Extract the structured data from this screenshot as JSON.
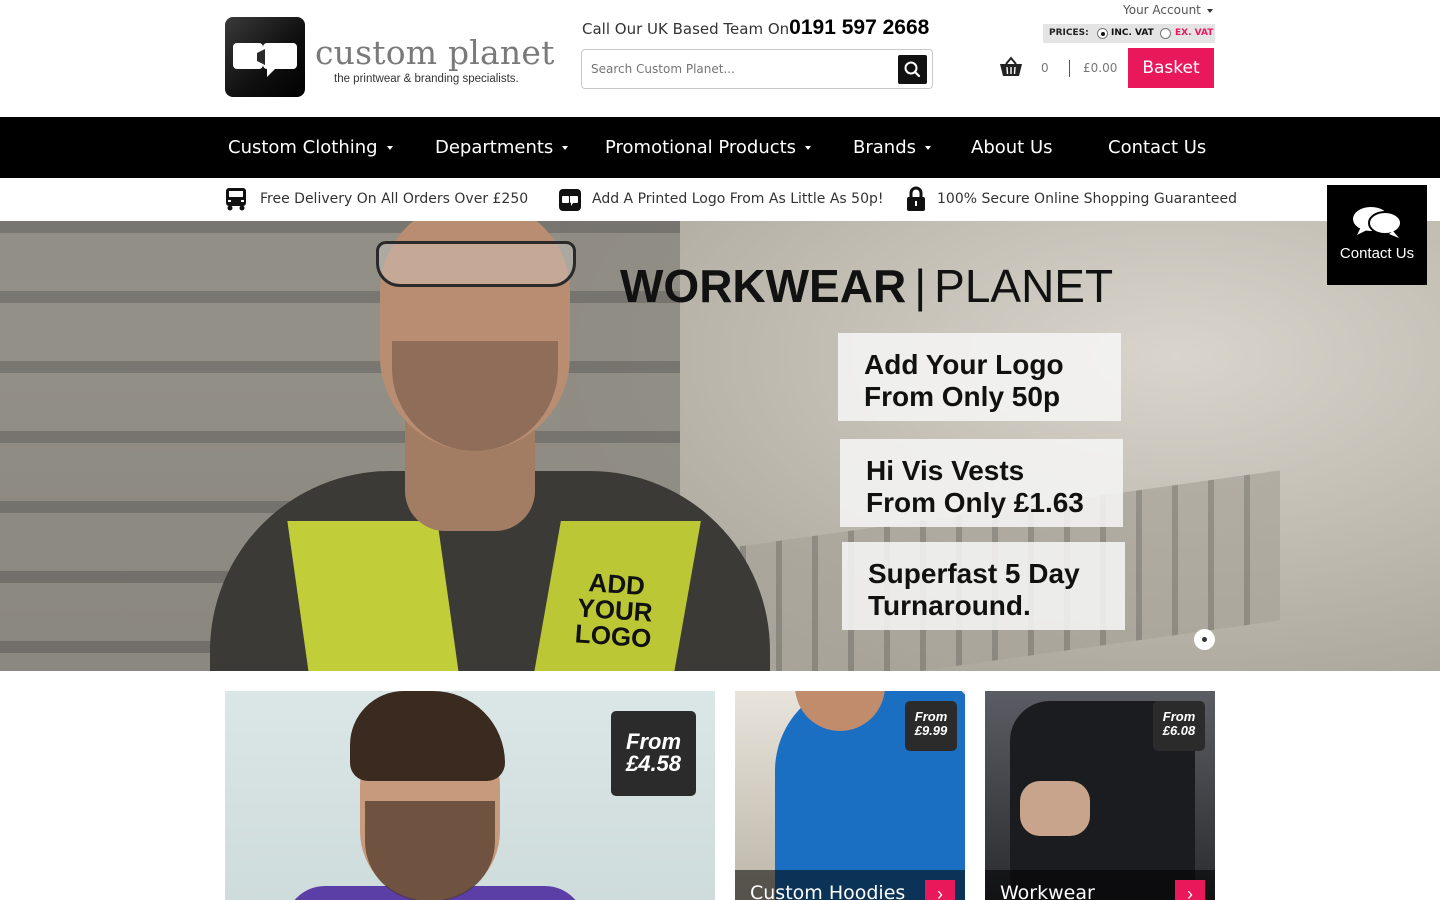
{
  "header": {
    "logo_name": "custom planet",
    "logo_tagline": "the printwear & branding specialists.",
    "call_label": "Call Our UK Based Team On",
    "call_number": "0191 597 2668",
    "search_placeholder": "Search Custom Planet...",
    "account_label": "Your Account",
    "prices_label": "PRICES:",
    "price_inc": "INC. VAT",
    "price_ex": "EX. VAT",
    "basket_count": "0",
    "basket_total": "£0.00",
    "basket_label": "Basket",
    "accent_color": "#e8185b"
  },
  "nav": {
    "items": [
      {
        "label": "Custom Clothing"
      },
      {
        "label": "Departments"
      },
      {
        "label": "Promotional Products"
      },
      {
        "label": "Brands"
      },
      {
        "label": "About Us"
      },
      {
        "label": "Contact Us"
      }
    ]
  },
  "usp": {
    "items": [
      {
        "icon": "delivery-truck-icon",
        "label": "Free Delivery On All Orders Over £250"
      },
      {
        "icon": "custom-planet-logo-icon",
        "label": "Add A Printed Logo From As Little As 50p!"
      },
      {
        "icon": "padlock-icon",
        "label": "100% Secure Online Shopping Guaranteed"
      }
    ]
  },
  "hero": {
    "title_bold": "WORKWEAR",
    "title_sep": "|",
    "title_light": "PLANET",
    "promos": [
      {
        "line1": "Add Your Logo",
        "line2": "From Only 50p"
      },
      {
        "line1": "Hi Vis Vests",
        "line2": "From Only £1.63"
      },
      {
        "line1": "Superfast 5 Day",
        "line2": "Turnaround."
      }
    ],
    "vest_text_1": "ADD",
    "vest_text_2": "YOUR",
    "vest_text_3": "LOGO"
  },
  "contact_float": {
    "label": "Contact Us"
  },
  "tiles": [
    {
      "price_from": "From",
      "price": "£4.58"
    },
    {
      "price_from": "From",
      "price": "£9.99",
      "caption": "Custom Hoodies"
    },
    {
      "price_from": "From",
      "price": "£6.08",
      "caption": "Workwear"
    }
  ]
}
